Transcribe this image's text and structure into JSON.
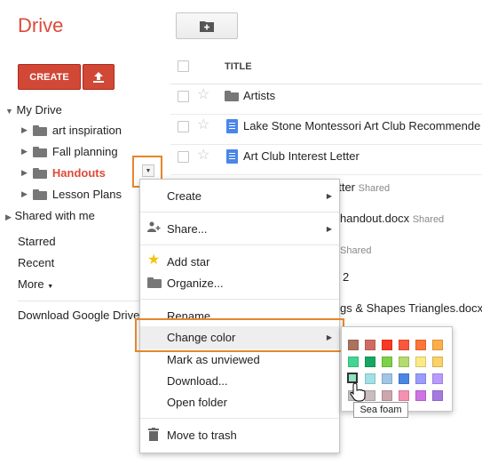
{
  "app": {
    "logo": "Drive"
  },
  "toolbar": {
    "create_label": "CREATE"
  },
  "sidebar": {
    "my_drive": "My Drive",
    "folders": [
      {
        "label": "art inspiration"
      },
      {
        "label": "Fall planning"
      },
      {
        "label": "Handouts",
        "selected": true
      },
      {
        "label": "Lesson Plans"
      }
    ],
    "shared_with_me": "Shared with me",
    "starred": "Starred",
    "recent": "Recent",
    "more": "More",
    "download": "Download Google Drive"
  },
  "table": {
    "header_title": "TITLE",
    "rows": [
      {
        "name": "Artists",
        "type": "folder",
        "shared": ""
      },
      {
        "name": "Lake Stone Montessori Art Club Recommende",
        "type": "doc",
        "shared": ""
      },
      {
        "name": "Art Club Interest Letter",
        "type": "doc",
        "shared": ""
      },
      {
        "name": "etter",
        "type": "doc",
        "shared": "Shared"
      },
      {
        "name": "handout.docx",
        "type": "doc",
        "shared": "Shared"
      },
      {
        "name": "",
        "type": "doc",
        "shared": "Shared"
      },
      {
        "name": "2",
        "type": "doc",
        "shared": ""
      },
      {
        "name": "gs & Shapes Triangles.docx",
        "type": "doc",
        "shared": ""
      }
    ]
  },
  "context_menu": {
    "create": "Create",
    "share": "Share...",
    "add_star": "Add star",
    "organize": "Organize...",
    "rename": "Rename...",
    "change_color": "Change color",
    "mark_unviewed": "Mark as unviewed",
    "download": "Download...",
    "open_folder": "Open folder",
    "move_to_trash": "Move to trash"
  },
  "color_palette": {
    "colors": [
      [
        "#ac725e",
        "#d06b64",
        "#f83a22",
        "#fa573c",
        "#ff7537",
        "#ffad46"
      ],
      [
        "#42d692",
        "#16a765",
        "#7bd148",
        "#b3dc6c",
        "#fbe983",
        "#fad165"
      ],
      [
        "#92e1c0",
        "#9fe1e7",
        "#9fc6e7",
        "#4986e7",
        "#9a9cff",
        "#b99aff"
      ],
      [
        "#c2c2c2",
        "#cabdbf",
        "#cca6ac",
        "#f691b2",
        "#cd74e6",
        "#a47ae2"
      ]
    ],
    "hovered": "Sea foam",
    "tooltip": "Sea foam"
  }
}
